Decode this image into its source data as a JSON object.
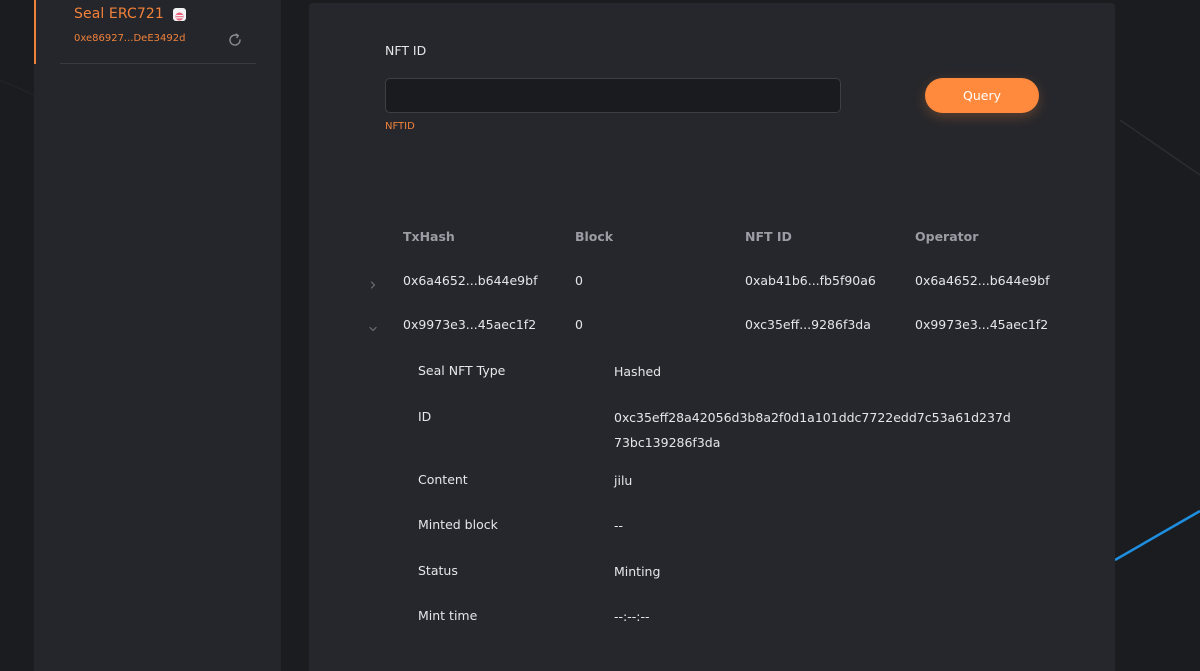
{
  "sidebar": {
    "contract": {
      "name": "Seal ERC721",
      "address": "0xe86927...DeE3492d"
    }
  },
  "form": {
    "label": "NFT ID",
    "value": "",
    "placeholder": "",
    "error": "NFTID",
    "query_label": "Query"
  },
  "table": {
    "headers": {
      "txhash": "TxHash",
      "block": "Block",
      "nft_id": "NFT ID",
      "operator": "Operator"
    },
    "rows": [
      {
        "txhash": "0x6a4652...b644e9bf",
        "block": "0",
        "nft_id": "0xab41b6...fb5f90a6",
        "operator": "0x6a4652...b644e9bf",
        "expanded": false
      },
      {
        "txhash": "0x9973e3...45aec1f2",
        "block": "0",
        "nft_id": "0xc35eff...9286f3da",
        "operator": "0x9973e3...45aec1f2",
        "expanded": true
      }
    ],
    "details": {
      "type_label": "Seal NFT Type",
      "type_value": "Hashed",
      "id_label": "ID",
      "id_value": "0xc35eff28a42056d3b8a2f0d1a101ddc7722edd7c53a61d237d73bc139286f3da",
      "content_label": "Content",
      "content_value": "jilu",
      "minted_block_label": "Minted block",
      "minted_block_value": "--",
      "status_label": "Status",
      "status_value": "Minting",
      "mint_time_label": "Mint time",
      "mint_time_value": "--:--:--"
    }
  },
  "colors": {
    "accent": "#f0813a",
    "button": "#ff8a3d",
    "background": "#1b1c20",
    "panel": "#26272c",
    "sidebar": "#25262b",
    "decor_line": "#1e8fe0"
  },
  "icons": {
    "refresh": "refresh-icon",
    "badge": "contract-logo-icon",
    "collapsed": "chevron-right-icon",
    "expanded": "chevron-down-icon"
  }
}
